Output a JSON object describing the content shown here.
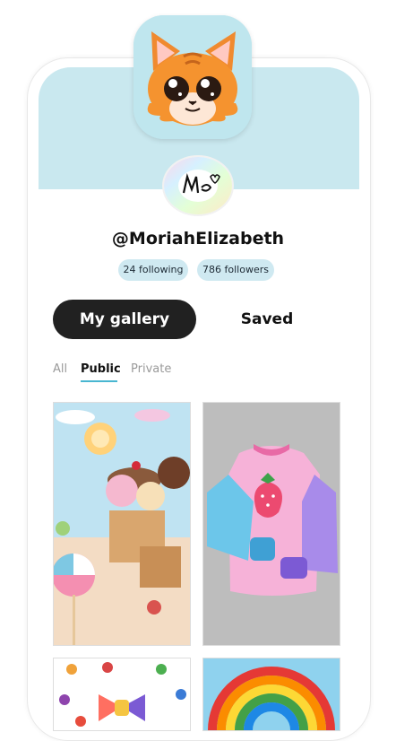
{
  "profile": {
    "username": "@MoriahElizabeth",
    "following": "24 following",
    "followers": "786 followers"
  },
  "tabs": {
    "gallery": "My gallery",
    "saved": "Saved"
  },
  "filters": [
    "All",
    "Public",
    "Private"
  ],
  "colors": {
    "banner": "#c9e8ef",
    "badge": "#cfe9f1",
    "active_tab": "#212121",
    "filter_underline": "#49b6d1"
  },
  "gallery": {
    "items": [
      {
        "icon": "candy-land-artwork"
      },
      {
        "icon": "strawberry-shirt-artwork"
      },
      {
        "icon": "rainbow-bow-artwork"
      },
      {
        "icon": "rainbow-artwork"
      }
    ]
  }
}
